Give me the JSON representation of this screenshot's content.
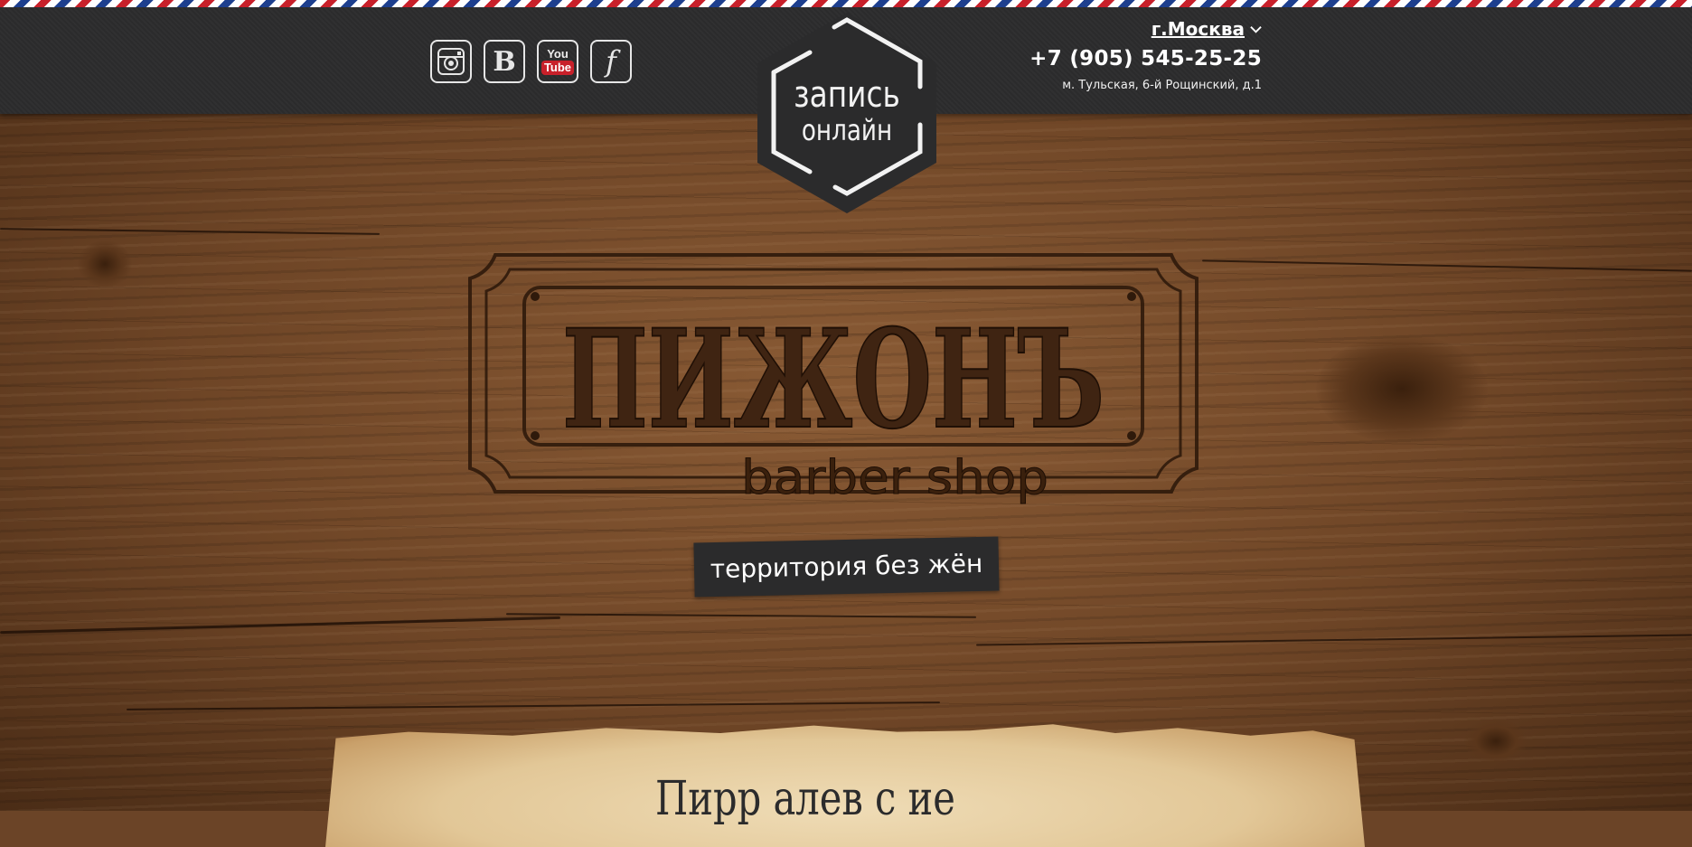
{
  "header": {
    "social": [
      {
        "name": "instagram",
        "icon": "instagram-icon"
      },
      {
        "name": "vkontakte",
        "icon": "vk-icon",
        "glyph": "B"
      },
      {
        "name": "youtube",
        "icon": "youtube-icon",
        "you": "You",
        "tube": "Tube"
      },
      {
        "name": "facebook",
        "icon": "facebook-icon",
        "glyph": "f"
      }
    ],
    "booking": {
      "line1": "запись",
      "line2": "онлайн"
    },
    "city": "г.Москва",
    "phone": "+7 (905) 545-25-25",
    "address": "м. Тульская, 6-й Рощинский, д.1"
  },
  "hero": {
    "brand": "ПИЖОНЪ",
    "subtitle": "barber shop",
    "tagline": "территория без жён"
  },
  "paper": {
    "heading": "Пирр алев с ие"
  },
  "colors": {
    "topbar": "#2b2b2c",
    "stripe_red": "#c8202a",
    "stripe_blue": "#1d3f8e",
    "wood": "#6b4427",
    "engraving": "#2f1a0b"
  }
}
